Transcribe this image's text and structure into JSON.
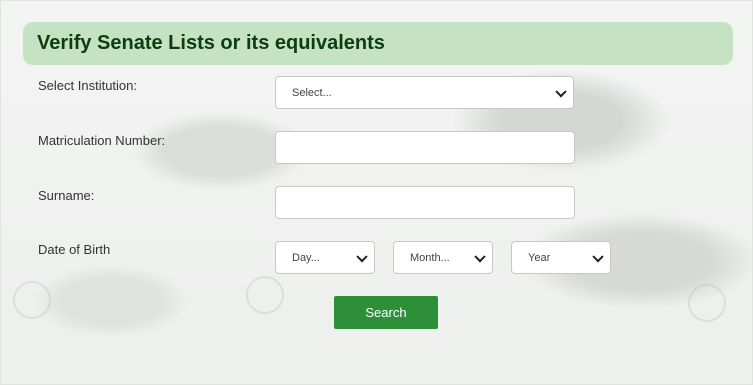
{
  "header": {
    "title": "Verify Senate Lists or its equivalents"
  },
  "form": {
    "institution_label": "Select Institution:",
    "institution_value": "Select...",
    "matric_label": "Matriculation Number:",
    "matric_value": "",
    "surname_label": "Surname:",
    "surname_value": "",
    "dob_label": "Date of Birth",
    "day_value": "Day...",
    "month_value": "Month...",
    "year_value": "Year",
    "search_label": "Search"
  },
  "colors": {
    "header_bg": "#c5e3c3",
    "title": "#0d3d0d",
    "button": "#2d8f38"
  }
}
